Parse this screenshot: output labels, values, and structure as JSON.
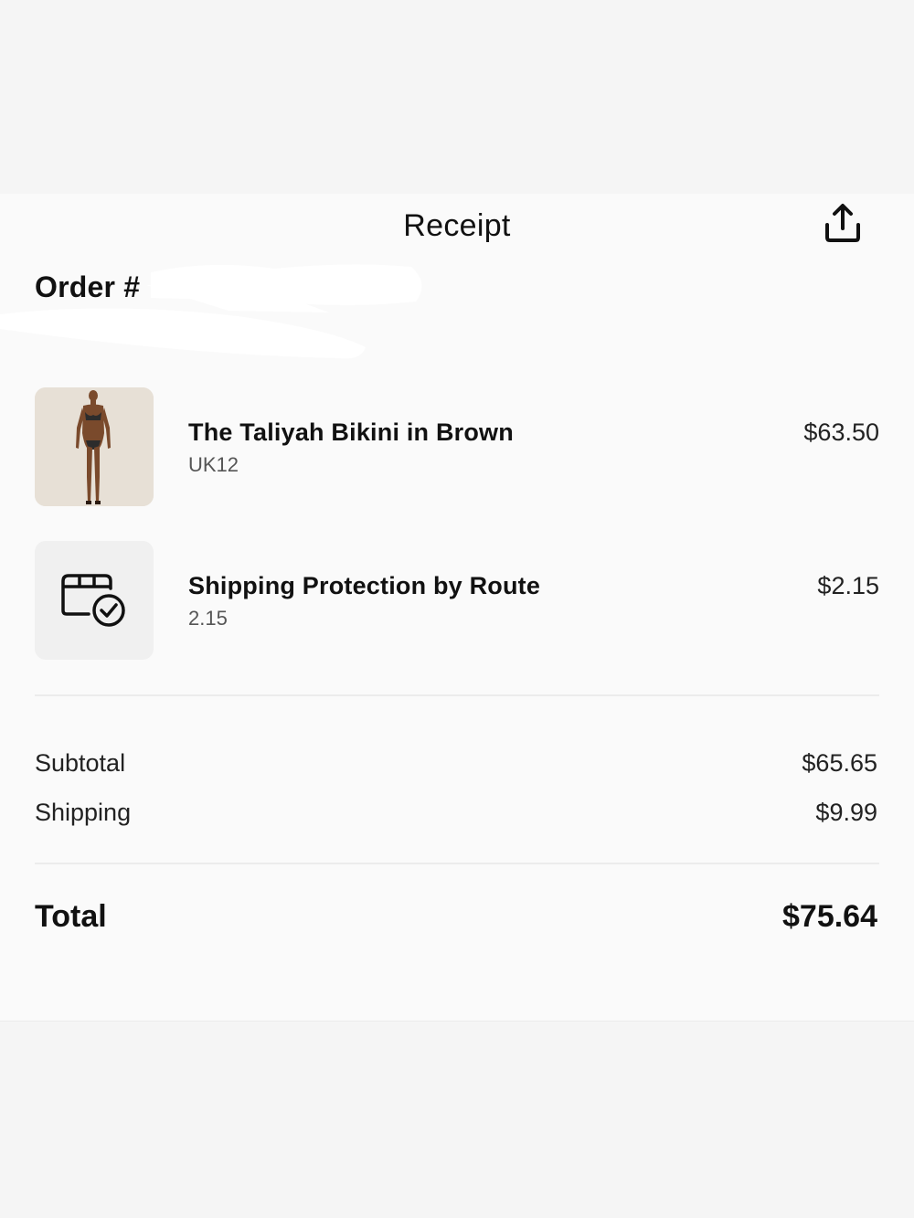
{
  "header": {
    "title": "Receipt",
    "share_icon": "share-icon"
  },
  "order": {
    "title": "Order #"
  },
  "items": [
    {
      "name": "The Taliyah Bikini in Brown",
      "variant": "UK12",
      "price": "$63.50",
      "thumb": "product-photo"
    },
    {
      "name": "Shipping Protection by Route",
      "variant": "2.15",
      "price": "$2.15",
      "thumb": "package-check-icon"
    }
  ],
  "summary": {
    "subtotal_label": "Subtotal",
    "subtotal_value": "$65.65",
    "shipping_label": "Shipping",
    "shipping_value": "$9.99",
    "total_label": "Total",
    "total_value": "$75.64"
  },
  "colors": {
    "background": "#f5f5f5",
    "sheet": "#fafafa",
    "photo_bg": "#e7e0d6",
    "skin": "#7a4a2c"
  }
}
